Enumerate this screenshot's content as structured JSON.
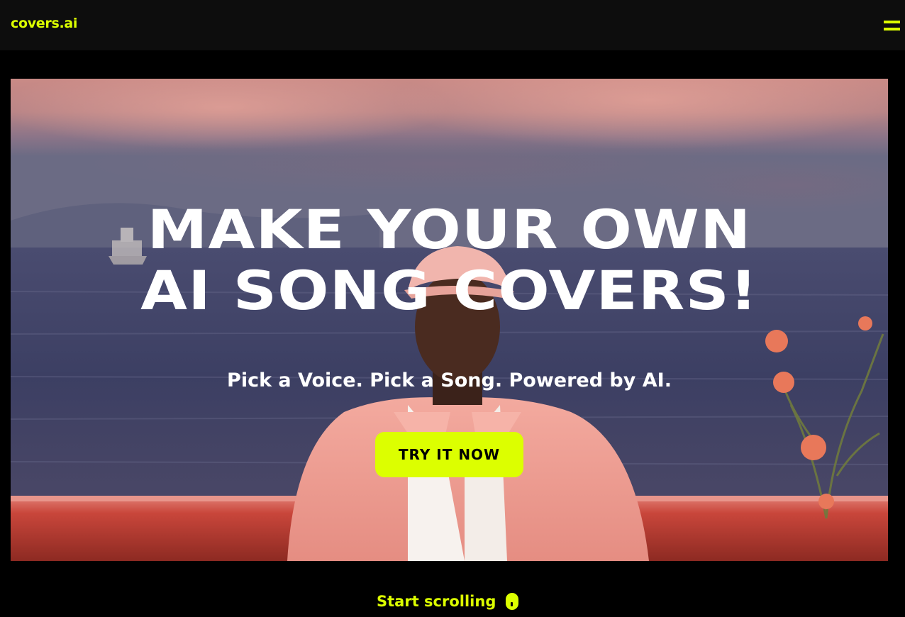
{
  "header": {
    "logo": "covers.ai",
    "menu_icon": "menu-icon"
  },
  "hero": {
    "headline_line1": "MAKE YOUR OWN",
    "headline_line2": "AI SONG COVERS!",
    "subheadline": "Pick a Voice. Pick a Song. Powered by AI.",
    "cta_label": "TRY IT NOW",
    "image": "man-in-pink-jacket-at-sea-sunset"
  },
  "footer": {
    "scroll_label": "Start scrolling",
    "scroll_icon": "mouse-icon"
  },
  "colors": {
    "accent": "#dcff00",
    "background": "#000000",
    "topbar": "#0d0d0d",
    "text": "#ffffff"
  }
}
